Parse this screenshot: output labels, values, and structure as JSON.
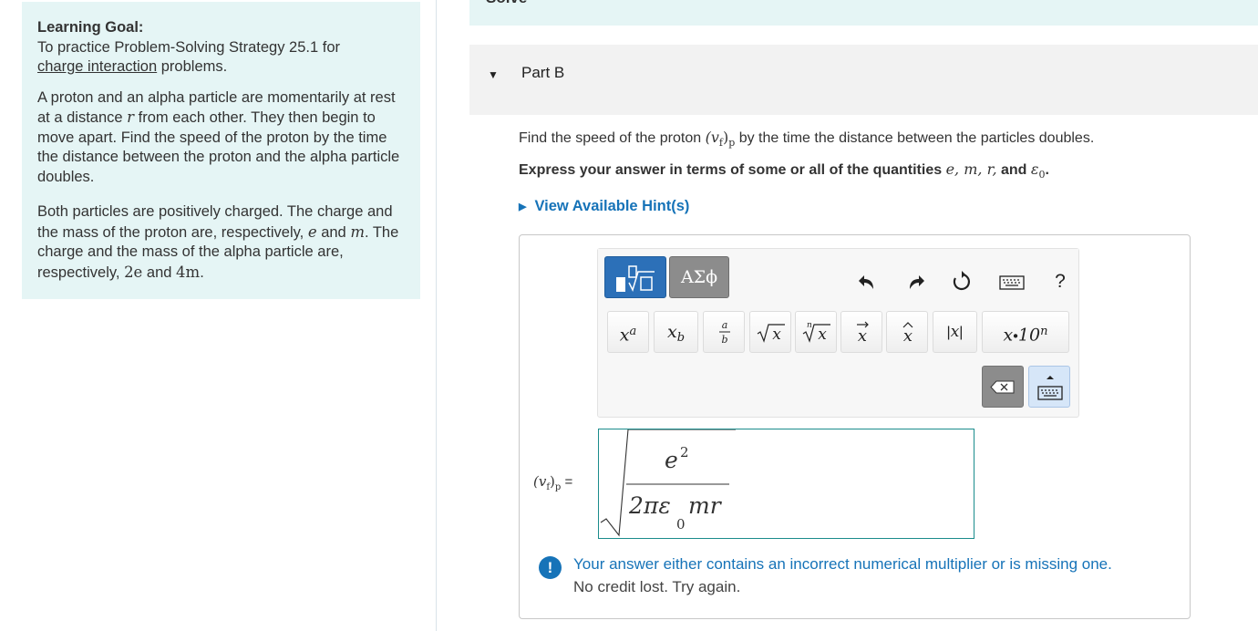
{
  "learning_goal": {
    "heading": "Learning Goal:",
    "intro_prefix": "To practice Problem-Solving Strategy 25.1 for",
    "intro_link": "charge interaction",
    "intro_suffix": " problems.",
    "para2_a": "A proton and an alpha particle are momentarily at rest at a distance ",
    "para2_var": "r",
    "para2_b": " from each other. They then begin to move apart. Find the speed of the proton by the time the distance between the proton and the alpha particle doubles.",
    "para3_a": "Both particles are positively charged. The charge and the mass of the proton are, respectively, ",
    "para3_e": "e",
    "para3_b": " and ",
    "para3_m": "m",
    "para3_c": ". The charge and the mass of the alpha particle are, respectively, ",
    "para3_2e": "2e",
    "para3_d": " and ",
    "para3_4m": "4m",
    "para3_end": "."
  },
  "solve_label": "Solve",
  "part": {
    "label": "Part B"
  },
  "question": {
    "prefix": "Find the speed of the proton ",
    "symbol": "(v",
    "symbol_sub": "f",
    "symbol_close": ")",
    "symbol_outer_sub": "p",
    "suffix": " by the time the distance between the particles doubles."
  },
  "instruction": {
    "prefix": "Express your answer in terms of some or all of the quantities ",
    "vars": "e, m, r,",
    "and": " and ",
    "eps": "ε",
    "eps_sub": "0",
    "end": "."
  },
  "hints_label": "View Available Hint(s)",
  "toolbar": {
    "tab_greek": "ΑΣϕ",
    "help": "?",
    "buttons": [
      "xª",
      "x_b",
      "a/b",
      "√x",
      "ⁿ√x",
      "x⃗",
      "x̂",
      "|x|",
      "x·10ⁿ"
    ]
  },
  "answer": {
    "label_prefix": "(v",
    "label_sub": "f",
    "label_close": ")",
    "label_outer_sub": "p",
    "label_eq": " =",
    "numerator": "e",
    "numerator_exp": "2",
    "denominator_a": "2πε",
    "denominator_sub": "0",
    "denominator_b": "mr"
  },
  "feedback": {
    "icon": "!",
    "main": "Your answer either contains an incorrect numerical multiplier or is missing one.",
    "sub": "No credit lost. Try again."
  },
  "colors": {
    "panel_bg": "#e5f5f5",
    "accent_blue": "#1673b8",
    "input_border": "#1b8c8c"
  }
}
